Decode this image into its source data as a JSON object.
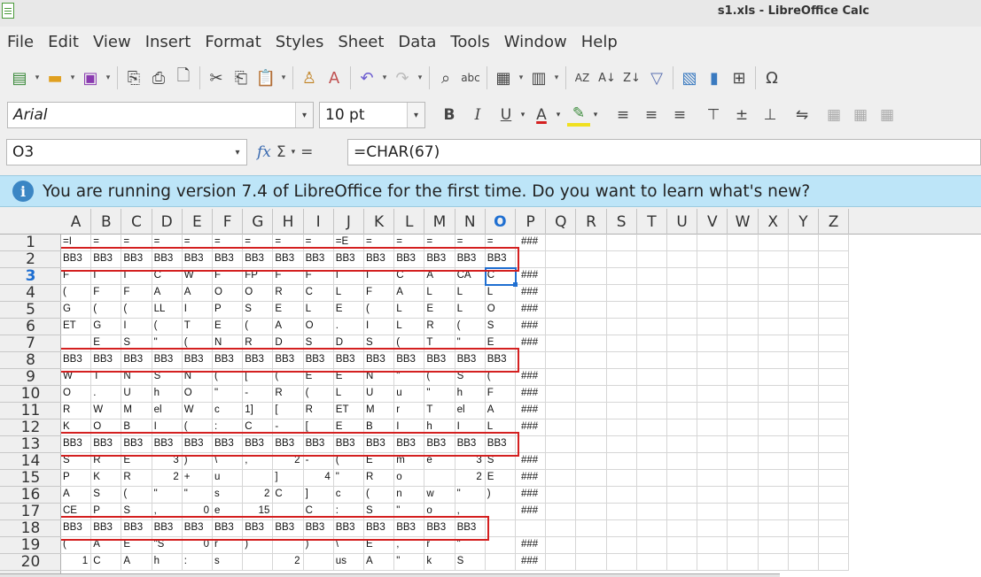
{
  "window": {
    "title": "s1.xls - LibreOffice Calc"
  },
  "menu": [
    "File",
    "Edit",
    "View",
    "Insert",
    "Format",
    "Styles",
    "Sheet",
    "Data",
    "Tools",
    "Window",
    "Help"
  ],
  "toolbar_icons": [
    "new-icon",
    "open-icon",
    "save-icon",
    "export-pdf-icon",
    "print-icon",
    "print-preview-icon",
    "cut-icon",
    "copy-icon",
    "paste-icon",
    "clone-formatting-icon",
    "clear-formatting-icon",
    "undo-icon",
    "redo-icon",
    "find-replace-icon",
    "spelling-icon",
    "row-icon",
    "column-icon",
    "sort-icon",
    "sort-ascending-icon",
    "sort-descending-icon",
    "autofilter-icon",
    "image-icon",
    "chart-icon",
    "pivot-table-icon",
    "special-character-icon"
  ],
  "format": {
    "font_name": "Arial",
    "font_size": "10 pt",
    "bold": "B",
    "italic": "I",
    "underline": "U",
    "font_color": "A"
  },
  "formula": {
    "cell_ref": "O3",
    "fx": "fx",
    "sum": "Σ",
    "equals": "=",
    "content": "=CHAR(67)"
  },
  "infobar": {
    "text": "You are running version 7.4 of LibreOffice for the first time. Do you want to learn what's new?"
  },
  "grid": {
    "columns": [
      "A",
      "B",
      "C",
      "D",
      "E",
      "F",
      "G",
      "H",
      "I",
      "J",
      "K",
      "L",
      "M",
      "N",
      "O",
      "P",
      "Q",
      "R",
      "S",
      "T",
      "U",
      "V",
      "W",
      "X",
      "Y",
      "Z"
    ],
    "active_column": "O",
    "active_row": "3",
    "rows": [
      {
        "n": "1",
        "cells": [
          "=I",
          "=",
          "=",
          "=",
          "=",
          "=",
          "=",
          "=",
          "=",
          "=E",
          "=",
          "=",
          "=",
          "=",
          "=",
          "###"
        ]
      },
      {
        "n": "2",
        "cells": [
          "BB3",
          "BB3",
          "BB3",
          "BB3",
          "BB3",
          "BB3",
          "BB3",
          "BB3",
          "BB3",
          "BB3",
          "BB3",
          "BB3",
          "BB3",
          "BB3",
          "BB3",
          ""
        ]
      },
      {
        "n": "3",
        "cells": [
          "F",
          "I",
          "I",
          "C",
          "W",
          "F",
          "FP",
          "F",
          "F",
          "I",
          "I",
          "C",
          "A",
          "CA",
          "C",
          "###"
        ]
      },
      {
        "n": "4",
        "cells": [
          "(",
          "F",
          "F",
          "A",
          "A",
          "O",
          "O",
          "R",
          "C",
          "L",
          "F",
          "A",
          "L",
          "L",
          "L",
          "###"
        ]
      },
      {
        "n": "5",
        "cells": [
          "G",
          "(",
          "(",
          "LL",
          "I",
          "P",
          "S",
          "E",
          "L",
          "E",
          "(",
          "L",
          "E",
          "L",
          "O",
          "###"
        ]
      },
      {
        "n": "6",
        "cells": [
          "ET",
          "G",
          "I",
          "(",
          "T",
          "E",
          "(",
          "A",
          "O",
          ".",
          "I",
          "L",
          "R",
          "(",
          "S",
          "###"
        ]
      },
      {
        "n": "7",
        "cells": [
          "",
          "E",
          "S",
          "\"",
          "(",
          "N",
          "R",
          "D",
          "S",
          "D",
          "S",
          "(",
          "T",
          "\"",
          "E",
          "###"
        ]
      },
      {
        "n": "8",
        "cells": [
          "BB3",
          "BB3",
          "BB3",
          "BB3",
          "BB3",
          "BB3",
          "BB3",
          "BB3",
          "BB3",
          "BB3",
          "BB3",
          "BB3",
          "BB3",
          "BB3",
          "BB3",
          ""
        ]
      },
      {
        "n": "9",
        "cells": [
          "W",
          "T",
          "N",
          "S",
          "N",
          "(",
          "[",
          "(",
          "E",
          "E",
          "N",
          "\"",
          "(",
          "S",
          "(",
          "###"
        ]
      },
      {
        "n": "10",
        "cells": [
          "O",
          ".",
          "U",
          "h",
          "O",
          "\"",
          "-",
          "R",
          "(",
          "L",
          "U",
          "u",
          "\"",
          "h",
          "F",
          "###"
        ]
      },
      {
        "n": "11",
        "cells": [
          "R",
          "W",
          "M",
          "el",
          "W",
          "c",
          "1]",
          "[",
          "R",
          "ET",
          "M",
          "r",
          "T",
          "el",
          "A",
          "###"
        ]
      },
      {
        "n": "12",
        "cells": [
          "K",
          "O",
          "B",
          "I",
          "(",
          ":",
          "C",
          "-",
          "[",
          "E",
          "B",
          "I",
          "h",
          "I",
          "L",
          "###"
        ]
      },
      {
        "n": "13",
        "cells": [
          "BB3",
          "BB3",
          "BB3",
          "BB3",
          "BB3",
          "BB3",
          "BB3",
          "BB3",
          "BB3",
          "BB3",
          "BB3",
          "BB3",
          "BB3",
          "BB3",
          "BB3",
          ""
        ]
      },
      {
        "n": "14",
        "cells": [
          "S",
          "R",
          "E",
          "3",
          ")",
          "\\",
          ",",
          "2",
          "-",
          "(",
          "E",
          "m",
          "e",
          "3",
          "S",
          "###"
        ]
      },
      {
        "n": "15",
        "cells": [
          "P",
          "K",
          "R",
          "2",
          "+",
          "u",
          "",
          "]",
          "4",
          "\"",
          "R",
          "o",
          "",
          "2",
          "E",
          "###"
        ]
      },
      {
        "n": "16",
        "cells": [
          "A",
          "S",
          "(",
          "\"",
          "\"",
          "s",
          "2",
          "C",
          "]",
          "c",
          "(",
          "n",
          "w",
          "\"",
          ")",
          "###"
        ]
      },
      {
        "n": "17",
        "cells": [
          "CE",
          "P",
          "S",
          ",",
          "0",
          "e",
          "15",
          "",
          "C",
          ":",
          "S",
          "\"",
          "o",
          ",",
          "",
          "###"
        ]
      },
      {
        "n": "18",
        "cells": [
          "BB3",
          "BB3",
          "BB3",
          "BB3",
          "BB3",
          "BB3",
          "BB3",
          "BB3",
          "BB3",
          "BB3",
          "BB3",
          "BB3",
          "BB3",
          "BB3",
          "",
          ""
        ]
      },
      {
        "n": "19",
        "cells": [
          "(",
          "A",
          "E",
          "\"S",
          "0",
          "r",
          ")",
          "",
          ")",
          "\\",
          "E",
          ",",
          "r",
          "\"",
          "",
          "###"
        ]
      },
      {
        "n": "20",
        "cells": [
          "1",
          "C",
          "A",
          "h",
          ":",
          "s",
          "",
          "2",
          "",
          "us",
          "A",
          "\"",
          "k",
          "S",
          "",
          "###"
        ]
      }
    ]
  },
  "colors": {
    "selection": "#1f6fd1",
    "highlight_box": "#d42020",
    "infobar_bg": "#bde5f8"
  }
}
